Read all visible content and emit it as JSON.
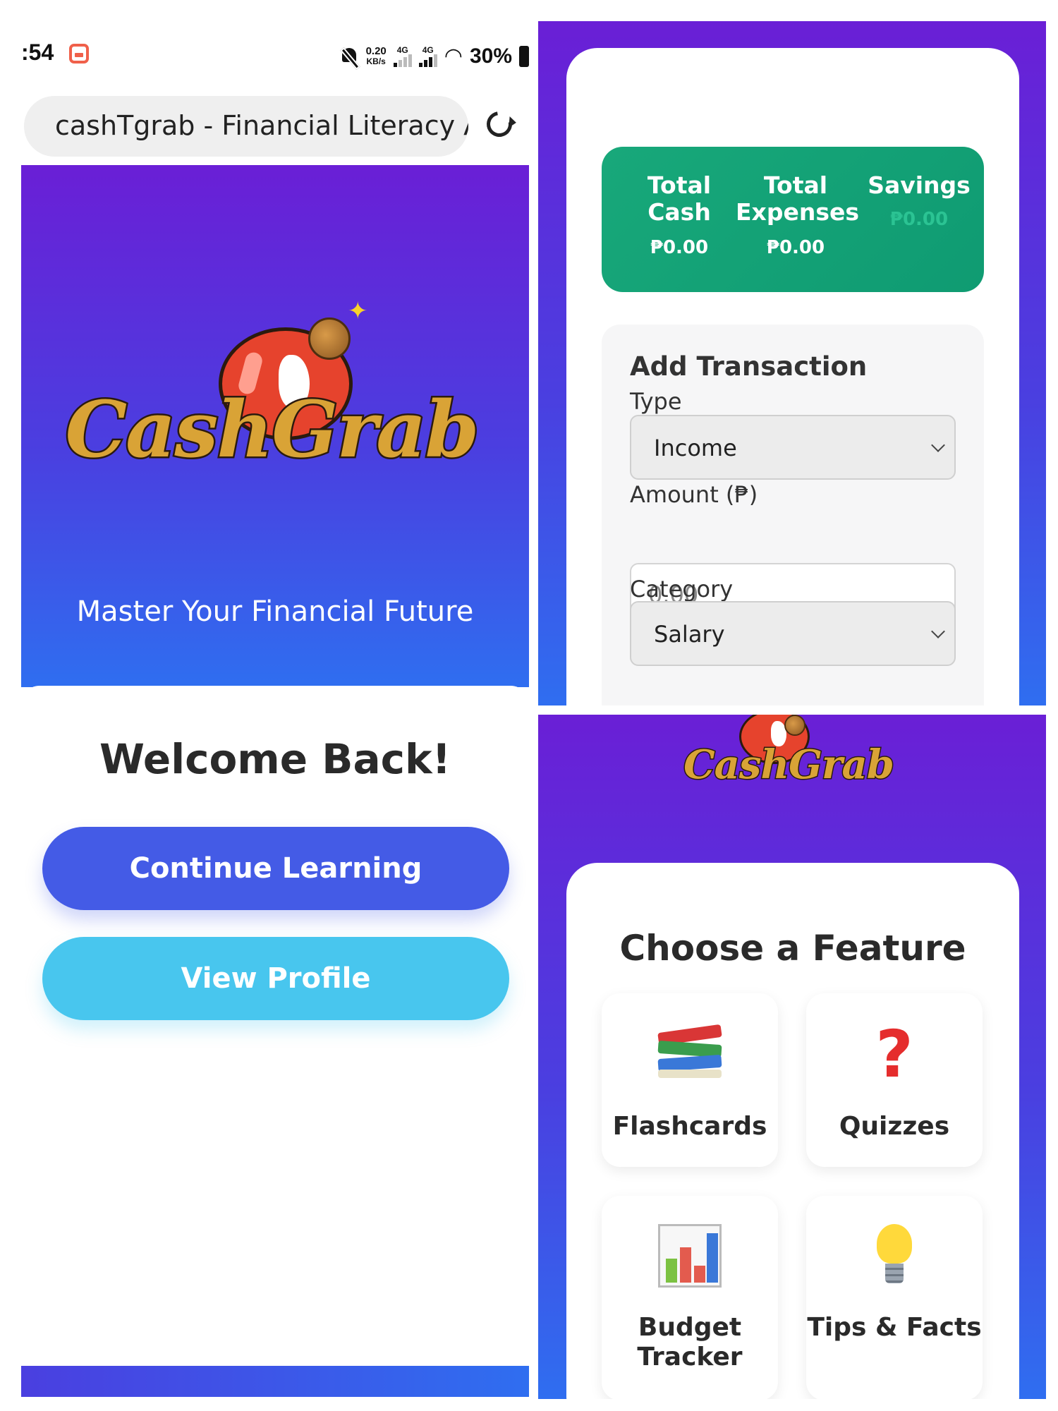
{
  "status_bar": {
    "time": ":54",
    "net_speed_value": "0.20",
    "net_speed_unit": "KB/s",
    "signal1_label": "4G",
    "signal2_label": "4G",
    "battery": "30%"
  },
  "browser": {
    "url_text": "cashTgrab - Financial Literacy Ap"
  },
  "hero": {
    "logo_text": "CashGrab",
    "tagline": "Master Your Financial Future"
  },
  "home": {
    "welcome": "Welcome Back!",
    "continue_label": "Continue Learning",
    "profile_label": "View Profile"
  },
  "summary": {
    "total_cash_label": "Total Cash",
    "total_cash_value": "₱0.00",
    "total_expenses_label": "Total Expenses",
    "total_expenses_value": "₱0.00",
    "savings_label": "Savings",
    "savings_value": "₱0.00"
  },
  "transaction_form": {
    "title": "Add Transaction",
    "type_label": "Type",
    "type_value": "Income",
    "amount_label": "Amount (₱)",
    "amount_placeholder": "0.00",
    "category_label": "Category",
    "category_value": "Salary"
  },
  "features": {
    "title": "Choose a Feature",
    "logo_text": "CashGrab",
    "items": [
      {
        "label": "Flashcards",
        "icon": "books-icon"
      },
      {
        "label": "Quizzes",
        "icon": "question-mark-icon"
      },
      {
        "label": "Budget Tracker",
        "icon": "bar-chart-icon"
      },
      {
        "label": "Tips & Facts",
        "icon": "light-bulb-icon"
      }
    ]
  },
  "colors": {
    "purple_top": "#6a1fd6",
    "blue_bottom": "#2f6ef0",
    "stats_green": "#18a87a",
    "primary_button": "#445be6",
    "secondary_button": "#48c6ee",
    "logo_gold": "#d9a336",
    "balloon_red": "#e6432d"
  }
}
